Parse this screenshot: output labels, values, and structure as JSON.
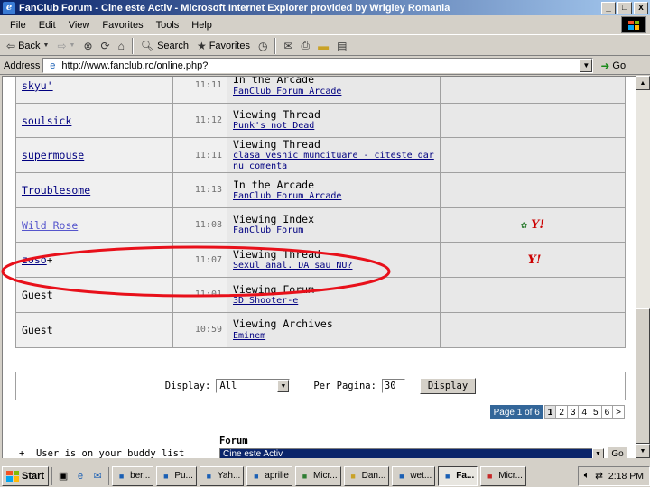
{
  "window": {
    "title": "FanClub Forum - Cine este Activ - Microsoft Internet Explorer provided by Wrigley Romania",
    "buttons": [
      "_",
      "□",
      "x"
    ]
  },
  "menu": [
    "File",
    "Edit",
    "View",
    "Favorites",
    "Tools",
    "Help"
  ],
  "toolbar": {
    "back": "Back",
    "search": "Search",
    "favorites": "Favorites"
  },
  "address": {
    "label": "Address",
    "url": "http://www.fanclub.ro/online.php?",
    "go": "Go"
  },
  "online_users": [
    {
      "user": "skyu'",
      "type": "link",
      "time": "11:11",
      "action": "In the Arcade",
      "target": "FanClub Forum Arcade",
      "icons": []
    },
    {
      "user": "soulsick",
      "type": "link",
      "time": "11:12",
      "action": "Viewing Thread",
      "target": "Punk's not Dead",
      "icons": []
    },
    {
      "user": "supermouse",
      "type": "link",
      "time": "11:11",
      "action": "Viewing Thread",
      "target": "clasa vesnic muncituare - citeste dar nu comenta",
      "icons": []
    },
    {
      "user": "Troublesome",
      "type": "link",
      "time": "11:13",
      "action": "In the Arcade",
      "target": "FanClub Forum Arcade",
      "icons": []
    },
    {
      "user": "Wild Rose",
      "type": "visited",
      "time": "11:08",
      "action": "Viewing Index",
      "target": "FanClub Forum",
      "icons": [
        "icq-icon",
        "yahoo-icon"
      ]
    },
    {
      "user": "zoso",
      "type": "link",
      "buddy": "+",
      "time": "11:07",
      "action": "Viewing Thread",
      "target": "Sexul anal. DA sau NU?",
      "icons": [
        "yahoo-icon"
      ]
    },
    {
      "user": "Guest",
      "type": "guest",
      "time": "11:01",
      "action": "Viewing Forum",
      "target": "3D Shooter-e",
      "icons": []
    },
    {
      "user": "Guest",
      "type": "guest",
      "time": "10:59",
      "action": "Viewing Archives",
      "target": "Eminem",
      "icons": []
    }
  ],
  "display_bar": {
    "display_label": "Display:",
    "display_value": "All",
    "per_page_label": "Per Pagina:",
    "per_page_value": "30",
    "button": "Display"
  },
  "pagination": {
    "info": "Page 1 of 6",
    "pages": [
      "1",
      "2",
      "3",
      "4",
      "5",
      "6",
      ">"
    ],
    "current": "1"
  },
  "legend": "+  User is on your buddy list",
  "forum_jump": {
    "label": "Forum",
    "selected": "Cine este Activ",
    "go": "Go"
  },
  "taskbar": {
    "start": "Start",
    "tasks": [
      "ber...",
      "Pu...",
      "Yah...",
      "aprilie",
      "Micr...",
      "Dan...",
      "wet...",
      "Fa...",
      "Micr..."
    ],
    "active_task": "Fa...",
    "clock": "2:18 PM"
  },
  "colors": {
    "title_gradient_start": "#0a246a",
    "title_gradient_end": "#a6caf0",
    "link": "#000080",
    "annotation": "#e8101a",
    "pagination_info_bg": "#336699"
  }
}
